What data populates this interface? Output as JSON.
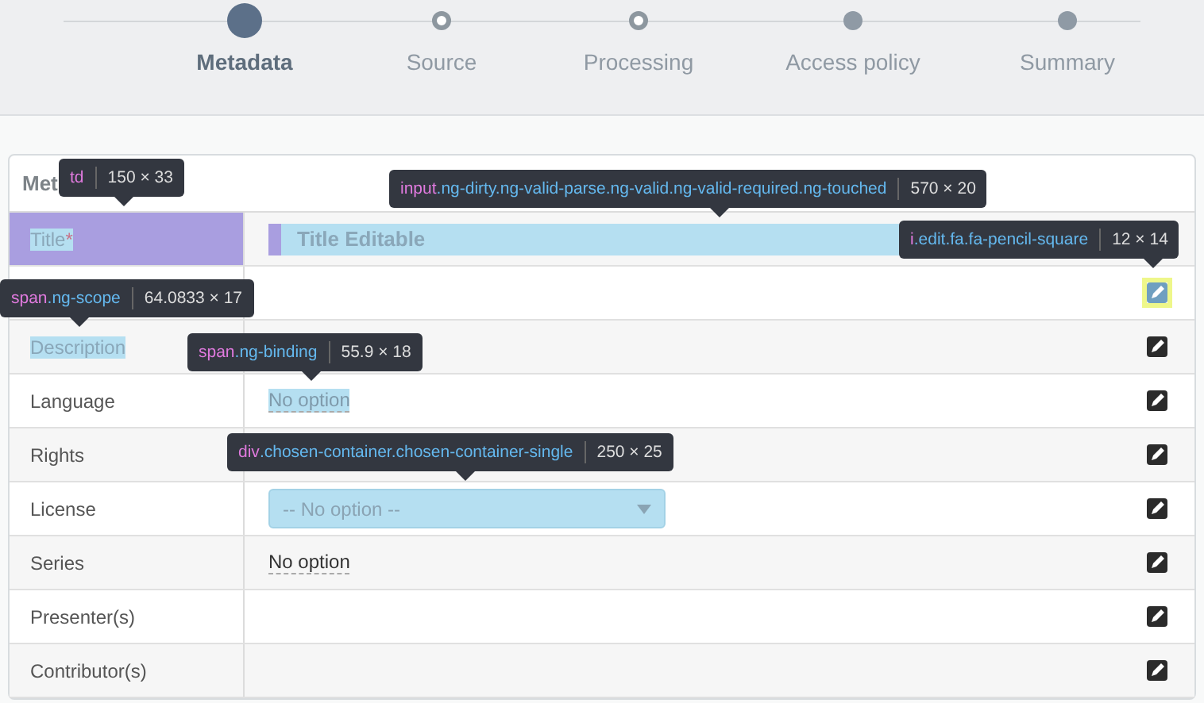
{
  "steps": [
    {
      "label": "Metadata",
      "kind": "current"
    },
    {
      "label": "Source",
      "kind": "visited"
    },
    {
      "label": "Processing",
      "kind": "visited"
    },
    {
      "label": "Access policy",
      "kind": "pending"
    },
    {
      "label": "Summary",
      "kind": "pending"
    }
  ],
  "section": {
    "heading": "Met"
  },
  "rows": [
    {
      "label": "Title",
      "required": "*",
      "cell_highlighted": true,
      "label_highlighted": true,
      "kind": "input",
      "value": "Title Editable",
      "value_highlighted": true
    },
    {
      "kind": "none",
      "edit_highlighted": true
    },
    {
      "label": "Description",
      "cell_highlighted": false,
      "label_highlighted": true,
      "kind": "none",
      "edit_highlighted": false
    },
    {
      "label": "Language",
      "cell_highlighted": false,
      "label_highlighted": false,
      "kind": "text",
      "value": "No option",
      "value_highlighted": true,
      "edit_highlighted": false
    },
    {
      "label": "Rights",
      "cell_highlighted": false,
      "label_highlighted": false,
      "kind": "none",
      "edit_highlighted": false
    },
    {
      "label": "License",
      "cell_highlighted": false,
      "label_highlighted": false,
      "kind": "select",
      "value": "-- No option --",
      "value_highlighted": true,
      "edit_highlighted": false
    },
    {
      "label": "Series",
      "cell_highlighted": false,
      "label_highlighted": false,
      "kind": "text",
      "value": "No option",
      "value_highlighted": false,
      "edit_highlighted": false
    },
    {
      "label": "Presenter(s)",
      "cell_highlighted": false,
      "label_highlighted": false,
      "kind": "none",
      "edit_highlighted": false
    },
    {
      "label": "Contributor(s)",
      "cell_highlighted": false,
      "label_highlighted": false,
      "kind": "none",
      "edit_highlighted": false
    }
  ],
  "inspector_tooltips": [
    {
      "tag": "td",
      "size": "150 × 33"
    },
    {
      "tag": "input",
      "classes": ".ng-dirty.ng-valid-parse.ng-valid.ng-valid-required.ng-touched",
      "size": "570 × 20"
    },
    {
      "tag": "i",
      "classes": ".edit.fa.fa-pencil-square",
      "size": "12 × 14"
    },
    {
      "tag": "span",
      "classes": ".ng-scope",
      "size": "64.0833 × 17"
    },
    {
      "tag": "span",
      "classes": ".ng-binding",
      "size": "55.9 × 18"
    },
    {
      "tag": "div",
      "classes": ".chosen-container.chosen-container-single",
      "size": "250 × 25"
    }
  ]
}
